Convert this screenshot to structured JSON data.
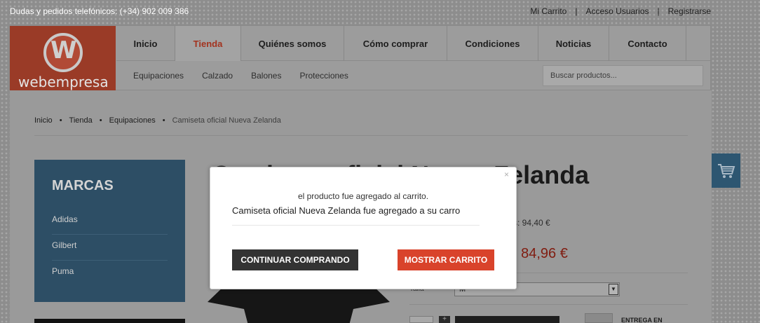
{
  "topbar": {
    "phone": "Dudas y pedidos telefónicos: (+34) 902 009 386",
    "links": [
      "Mi Carrito",
      "Acceso Usuarios",
      "Registrarse"
    ]
  },
  "logo": {
    "letter": "W",
    "brand": "webempresa"
  },
  "nav": {
    "items": [
      "Inicio",
      "Tienda",
      "Quiénes somos",
      "Cómo comprar",
      "Condiciones",
      "Noticias",
      "Contacto"
    ],
    "active": "Tienda"
  },
  "subnav": [
    "Equipaciones",
    "Calzado",
    "Balones",
    "Protecciones"
  ],
  "search": {
    "placeholder": "Buscar productos..."
  },
  "breadcrumb": [
    "Inicio",
    "Tienda",
    "Equipaciones",
    "Camiseta oficial Nueva Zelanda"
  ],
  "marcas": {
    "title": "MARCAS",
    "items": [
      "Adidas",
      "Gilbert",
      "Puma"
    ]
  },
  "product": {
    "title": "Camiseta oficial Nueva Zelanda",
    "old_price": "s: 94,40 €",
    "price": "84,96 €",
    "price_prefix": ":",
    "talla_label": "Talla",
    "talla_value": "M",
    "entrega": "ENTREGA EN"
  },
  "modal": {
    "close": "×",
    "message": "el producto fue agregado al carrito.",
    "detail": "Camiseta oficial Nueva Zelanda fue agregado a su carro",
    "continue_label": "CONTINUAR COMPRANDO",
    "cart_label": "MOSTRAR CARRITO"
  },
  "colors": {
    "accent": "#d9432b",
    "dark_button": "#333333",
    "sidebar": "#2d4e65"
  }
}
